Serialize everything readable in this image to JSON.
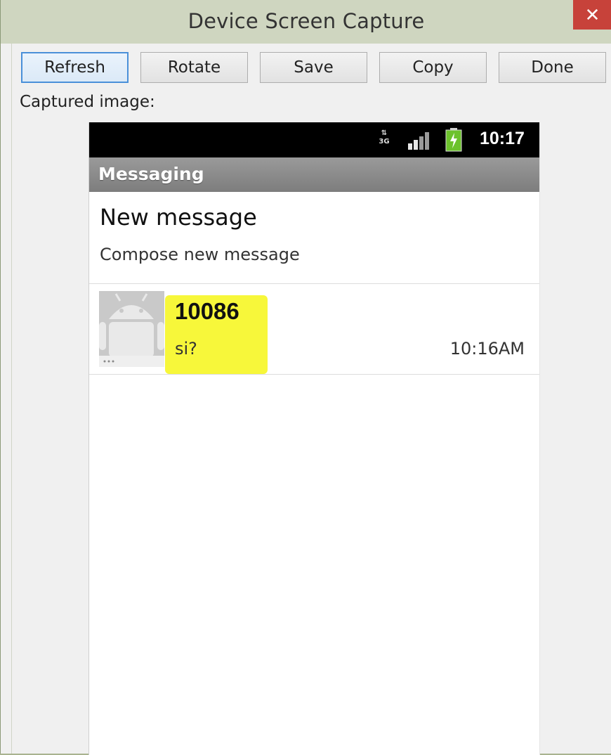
{
  "window": {
    "title": "Device Screen Capture",
    "close_glyph": "✕"
  },
  "toolbar": {
    "buttons": [
      {
        "label": "Refresh",
        "focused": true
      },
      {
        "label": "Rotate"
      },
      {
        "label": "Save"
      },
      {
        "label": "Copy"
      },
      {
        "label": "Done"
      }
    ]
  },
  "captured_label": "Captured image:",
  "phone": {
    "status_bar": {
      "network": "3G",
      "time": "10:17",
      "icons": [
        "3g-data-icon",
        "signal-strength-icon",
        "battery-charging-icon"
      ]
    },
    "app_title": "Messaging",
    "new_message": {
      "title": "New message",
      "subtitle": "Compose new message"
    },
    "conversations": [
      {
        "name": "10086",
        "snippet": "si?",
        "time": "10:16AM",
        "highlighted": true
      }
    ]
  },
  "colors": {
    "titlebar": "#cfd6c0",
    "close_button": "#c7423a",
    "highlight": "#f7f73a",
    "battery": "#6cc22c"
  }
}
